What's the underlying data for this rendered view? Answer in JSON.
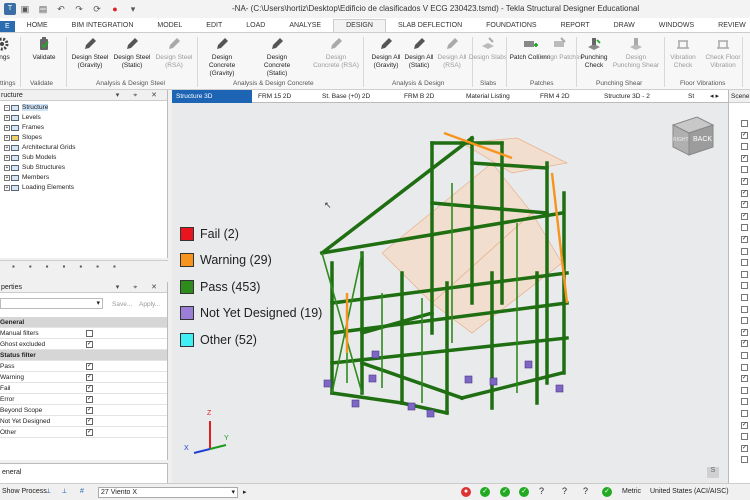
{
  "window": {
    "title": "-NA- (C:\\Users\\hortiz\\Desktop\\Edificio de clasificados V ECG 230423.tsmd) - Tekla Structural Designer Educational"
  },
  "menu": [
    "HOME",
    "BIM INTEGRATION",
    "MODEL",
    "EDIT",
    "LOAD",
    "ANALYSE",
    "DESIGN",
    "SLAB DEFLECTION",
    "FOUNDATIONS",
    "REPORT",
    "DRAW",
    "WINDOWS",
    "REVIEW"
  ],
  "menu_file": "E",
  "ribbon": {
    "settings": "ttings",
    "settings_group": "ttings",
    "validate": "Validate",
    "validate_group": "Validate",
    "design_steel_gravity": "Design Steel (Gravity)",
    "design_steel_static": "Design Steel (Static)",
    "design_steel_rsa": "Design Steel (RSA)",
    "steel_group": "Analysis & Design Steel",
    "design_concrete_gravity": "Design Concrete (Gravity)",
    "design_concrete_static": "Design Concrete (Static)",
    "design_concrete_rsa": "Design Concrete (RSA)",
    "concrete_group": "Analysis & Design Concrete",
    "design_all_gravity": "Design All (Gravity)",
    "design_all_static": "Design All (Static)",
    "design_all_rsa": "Design All (RSA)",
    "design_group": "Analysis & Design",
    "design_slabs": "Design Slabs",
    "slabs_group": "Slabs",
    "patch_column": "Patch Column",
    "design_patches": "Design Patches",
    "patches_group": "Patches",
    "punching_check": "Punching Check",
    "design_punching_shear": "Design Punching Shear",
    "punching_group": "Punching Shear",
    "vibration_check": "Vibration Check",
    "check_floor_vibration": "Check Floor Vibration",
    "floor_group": "Floor Vibrations"
  },
  "structure_panel": {
    "title": "ructure",
    "items": [
      "Structure",
      "Levels",
      "Frames",
      "Slopes",
      "Architectural Grids",
      "Sub Models",
      "Sub Structures",
      "Members",
      "Loading Elements"
    ]
  },
  "properties_panel": {
    "title": "perties",
    "save": "Save...",
    "apply": "Apply...",
    "sections": [
      {
        "name": "General",
        "rows": [
          {
            "label": "Manual filters",
            "checked": false
          },
          {
            "label": "Ghost excluded",
            "checked": true
          }
        ]
      },
      {
        "name": "Status filter",
        "rows": [
          {
            "label": "Pass",
            "checked": true
          },
          {
            "label": "Warning",
            "checked": true
          },
          {
            "label": "Fail",
            "checked": true
          },
          {
            "label": "Error",
            "checked": true
          },
          {
            "label": "Beyond Scope",
            "checked": true
          },
          {
            "label": "Not Yet Designed",
            "checked": true
          },
          {
            "label": "Other",
            "checked": true
          }
        ]
      }
    ],
    "footer": "eneral"
  },
  "tabs": [
    "Structure 3D",
    "FRM 15 2D",
    "St. Base (+0) 2D",
    "FRM B 2D",
    "Material Listing",
    "FRM 4 2D",
    "Structure 3D - 2",
    "St"
  ],
  "right_panel_title": "Scene",
  "viewport": {
    "view_cube_label": "BACK",
    "view_cube_side": "RIGHT",
    "legend": [
      {
        "label": "Fail (2)",
        "color": "#e8141e"
      },
      {
        "label": "Warning (29)",
        "color": "#f7941d"
      },
      {
        "label": "Pass (453)",
        "color": "#2e8b1e"
      },
      {
        "label": "Not Yet Designed (19)",
        "color": "#9b7fd6"
      },
      {
        "label": "Other (52)",
        "color": "#3ff0f4"
      }
    ],
    "axes": {
      "x": "X",
      "y": "Y",
      "z": "Z"
    }
  },
  "status": {
    "show_process": "Show Process",
    "loadcase": "27 Viento X",
    "units": "Metric",
    "code": "United States (ACI/AISC)"
  }
}
